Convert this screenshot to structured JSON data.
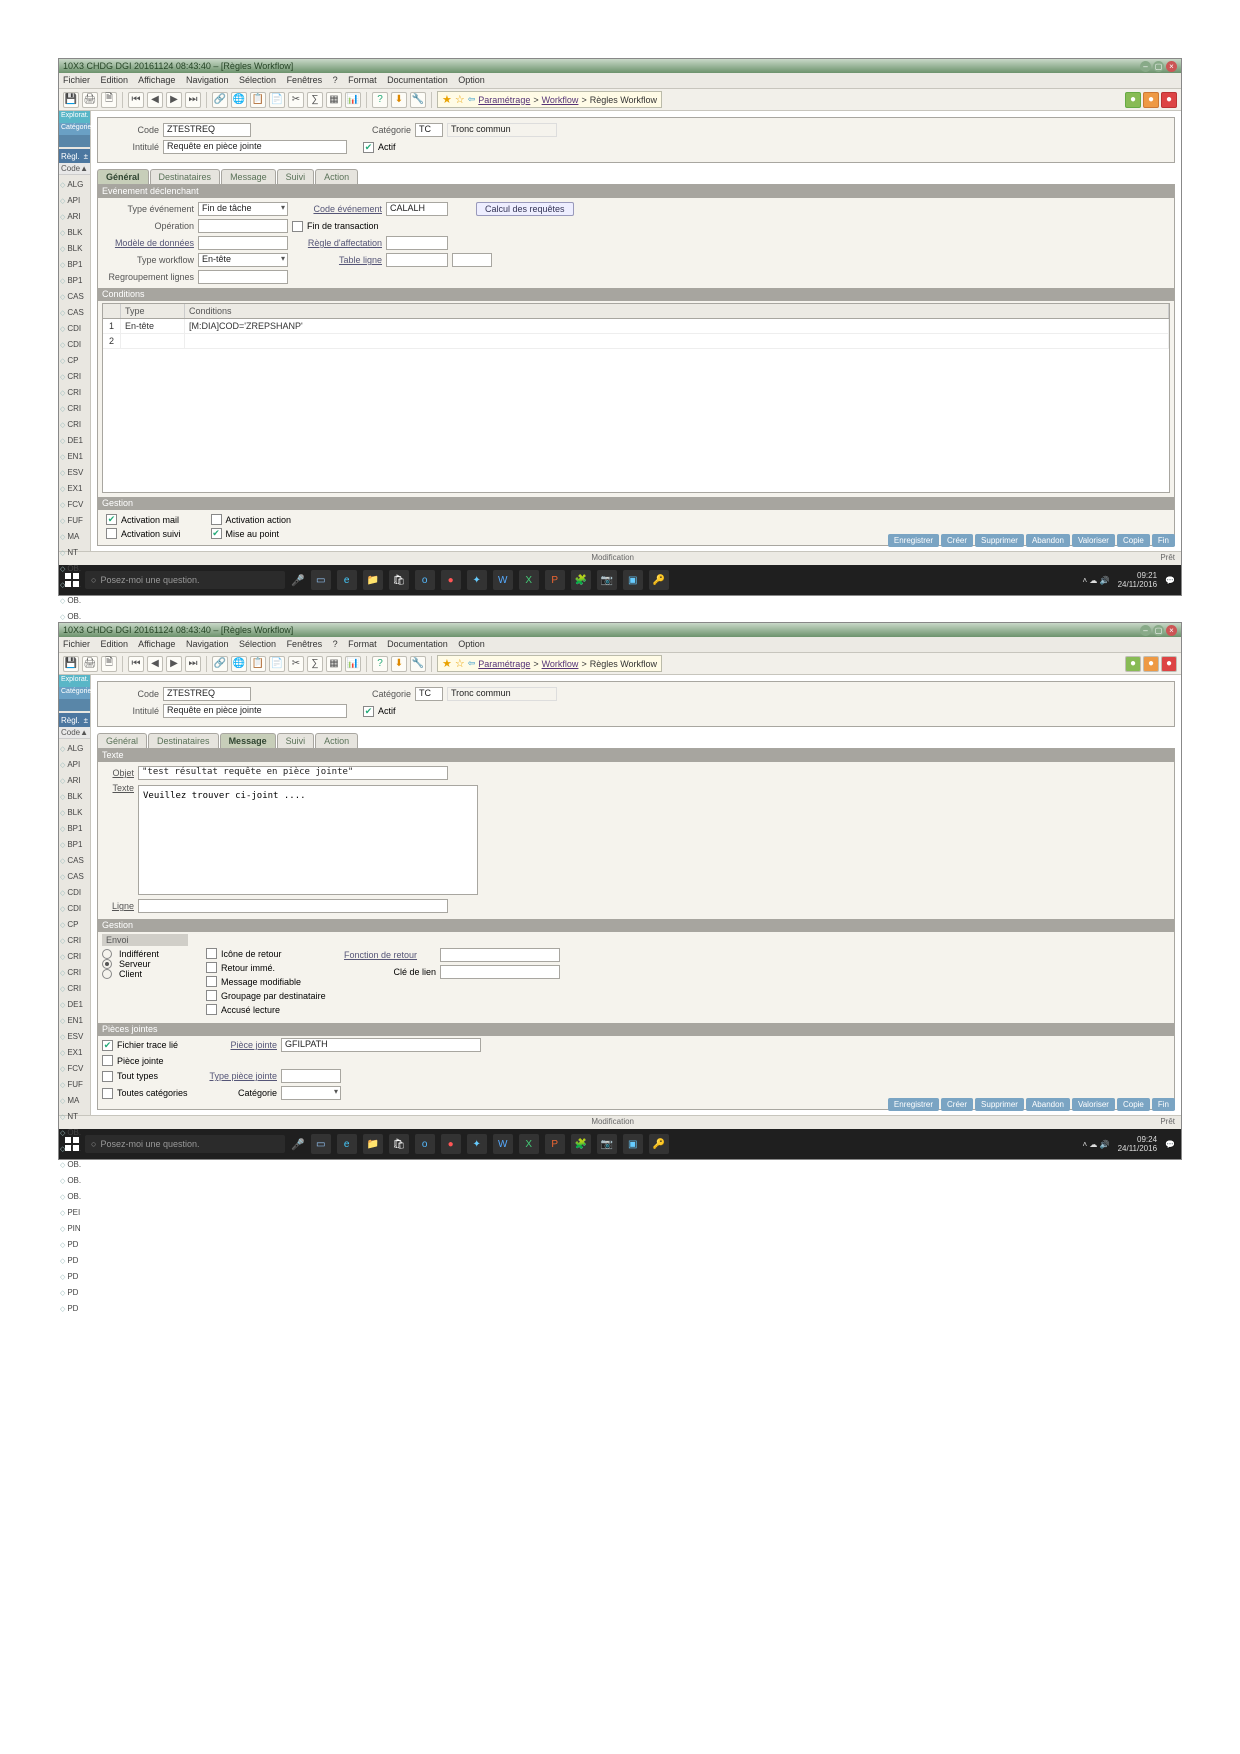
{
  "common": {
    "title": "10X3 CHDG DGI 20161124 08:43:40 – [Règles Workflow]",
    "menu": [
      "Fichier",
      "Edition",
      "Affichage",
      "Navigation",
      "Sélection",
      "Fenêtres",
      "?",
      "Format",
      "Documentation",
      "Option"
    ],
    "breadcrumb1": "Paramétrage",
    "breadcrumb2": "Workflow",
    "breadcrumb3": "Règles Workflow",
    "header": {
      "code_lbl": "Code",
      "code": "ZTESTREQ",
      "intitule_lbl": "Intitulé",
      "intitule": "Requête en pièce jointe",
      "categorie_lbl": "Catégorie",
      "categorie": "TC",
      "categorie_txt": "Tronc commun",
      "actif": "Actif"
    },
    "sidebar": [
      "Explorat.",
      "Catégorie",
      "",
      "Règl."
    ],
    "codelist_head": "Code",
    "codelist": [
      "ALG",
      "API",
      "ARI",
      "BLK",
      "BLK",
      "BP1",
      "BP1",
      "CAS",
      "CAS",
      "CDI",
      "CDI",
      "CP",
      "CRI",
      "CRI",
      "CRI",
      "CRI",
      "DE1",
      "EN1",
      "ESV",
      "EX1",
      "FCV",
      "FUF",
      "MA",
      "NT",
      "OB.",
      "OB.",
      "OB.",
      "OB.",
      "OB.",
      "PEI",
      "PIN",
      "PD",
      "PD",
      "PD",
      "PD",
      "PD"
    ],
    "footer_btns": [
      "Enregistrer",
      "Créer",
      "Supprimer",
      "Abandon",
      "Valoriser",
      "Copie",
      "Fin"
    ],
    "status_left": "",
    "status_mid": "Modification",
    "status_right": "Prêt",
    "search_ph": "Posez-moi une question."
  },
  "s1": {
    "tabs": [
      "Général",
      "Destinataires",
      "Message",
      "Suivi",
      "Action"
    ],
    "active_tab": "Général",
    "grp1": "Evénement déclenchant",
    "type_ev_lbl": "Type événement",
    "type_ev": "Fin de tâche",
    "op_lbl": "Opération",
    "fin_tr": "Fin de transaction",
    "code_ev_lbl": "Code événement",
    "code_ev": "CALALH",
    "calc_btn": "Calcul des requêtes",
    "modele_lbl": "Modèle de données",
    "regle_lbl": "Règle d'affectation",
    "type_wf_lbl": "Type workflow",
    "type_wf": "En-tête",
    "table_lbl": "Table ligne",
    "regroup_lbl": "Regroupement lignes",
    "grp2": "Conditions",
    "cond_head": [
      "",
      "Type",
      "Conditions"
    ],
    "cond_rows": [
      [
        "1",
        "En-tête",
        "[M:DIA]COD='ZREPSHANP'"
      ],
      [
        "2",
        "",
        ""
      ]
    ],
    "grp3": "Gestion",
    "gest": {
      "act_mail": "Activation mail",
      "act_suivi": "Activation suivi",
      "act_action": "Activation action",
      "map": "Mise au point"
    },
    "time": "09:21",
    "date": "24/11/2016"
  },
  "s2": {
    "tabs": [
      "Général",
      "Destinataires",
      "Message",
      "Suivi",
      "Action"
    ],
    "active_tab": "Message",
    "grp1": "Texte",
    "objet_lbl": "Objet",
    "objet": "\"test résultat requête en pièce jointe\"",
    "texte_lbl": "Texte",
    "texte": "Veuillez trouver ci-joint ....",
    "ligne_lbl": "Ligne",
    "grp2": "Gestion",
    "envoi_lbl": "Envoi",
    "envoi_opts": [
      "Indifférent",
      "Serveur",
      "Client"
    ],
    "icone_ret": "Icône de retour",
    "ret_immed": "Retour immé.",
    "msg_mod": "Message modifiable",
    "grp_dest": "Groupage par destinataire",
    "accuse": "Accusé lecture",
    "fonc_ret": "Fonction de retour",
    "cle_lien": "Clé de lien",
    "grp3": "Pièces jointes",
    "fich_trace": "Fichier trace lié",
    "piece_jointe": "Pièce jointe",
    "piece_jointe_v": "GFILPATH",
    "piece_j2": "Pièce jointe",
    "tous_types": "Tout types",
    "type_pj": "Type pièce jointe",
    "toutes_cat": "Toutes catégories",
    "cat": "Catégorie",
    "time": "09:24",
    "date": "24/11/2016"
  }
}
